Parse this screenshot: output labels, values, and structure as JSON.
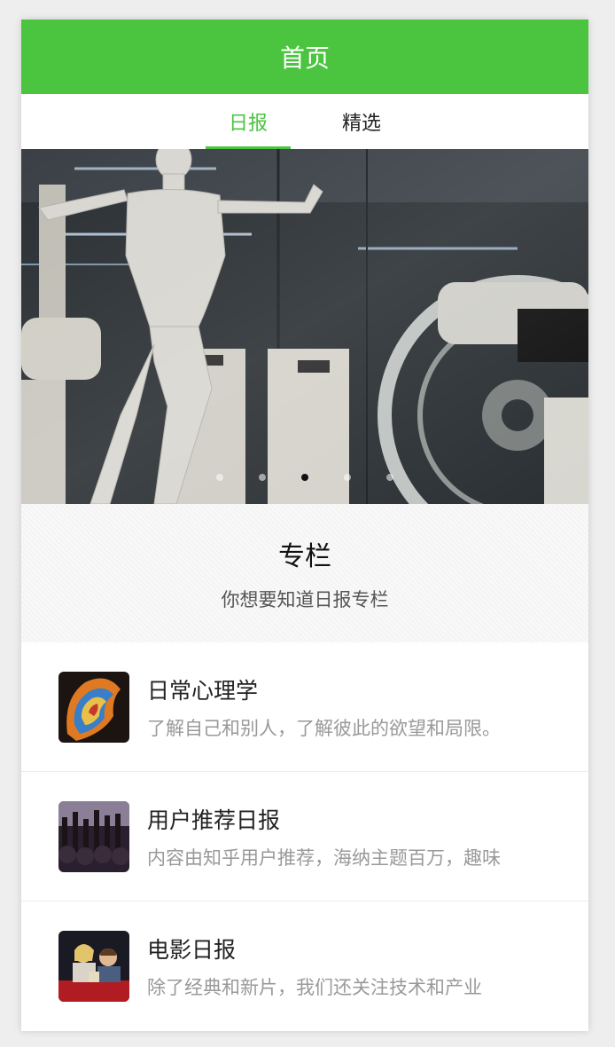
{
  "header": {
    "title": "首页"
  },
  "tabs": [
    {
      "label": "日报",
      "active": true
    },
    {
      "label": "精选",
      "active": false
    }
  ],
  "banner": {
    "image": "anatomical-robot-figure",
    "slides": 5,
    "active_slide": 3
  },
  "section": {
    "title": "专栏",
    "subtitle": "你想要知道日报专栏"
  },
  "columns": [
    {
      "title": "日常心理学",
      "desc": "了解自己和别人，了解彼此的欲望和局限。",
      "thumb": "psychology-art"
    },
    {
      "title": "用户推荐日报",
      "desc": "内容由知乎用户推荐，海纳主题百万，趣味",
      "thumb": "crowd-concert"
    },
    {
      "title": "电影日报",
      "desc": "除了经典和新片，我们还关注技术和产业",
      "thumb": "cinema-audience"
    }
  ],
  "colors": {
    "accent": "#4bc440"
  }
}
